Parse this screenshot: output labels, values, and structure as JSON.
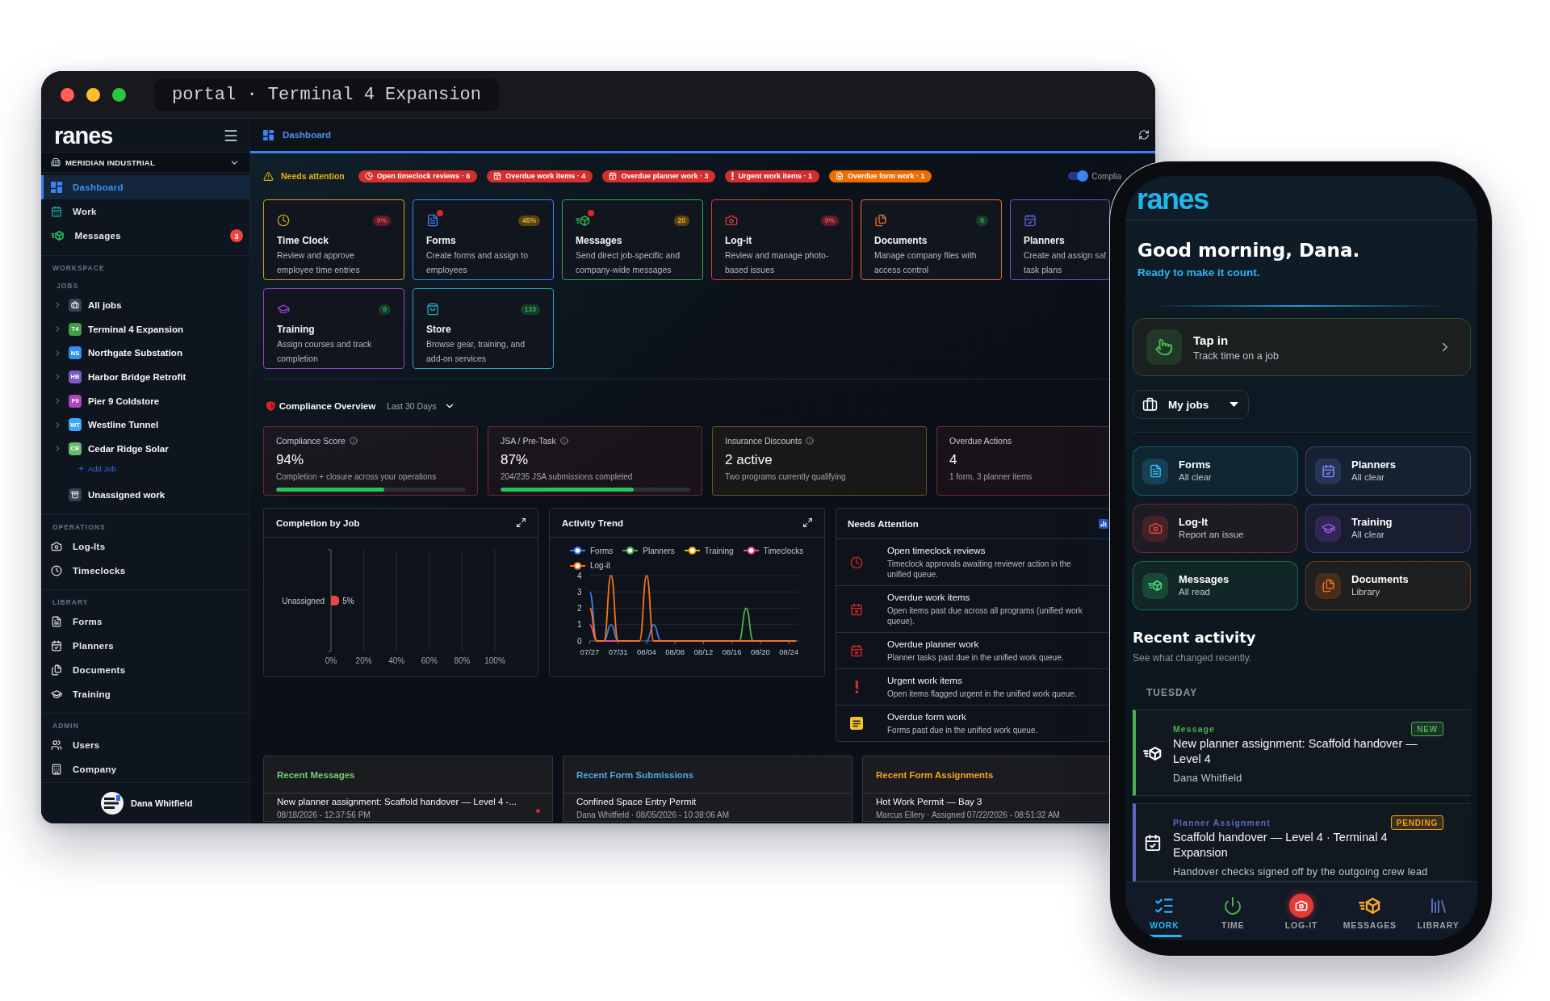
{
  "window": {
    "title": "portal · Terminal 4 Expansion"
  },
  "sidebar": {
    "logo": "ranes",
    "organization": "MERIDIAN INDUSTRIAL",
    "nav": [
      {
        "label": "Dashboard",
        "selected": true
      },
      {
        "label": "Work",
        "selected": false
      },
      {
        "label": "Messages",
        "selected": false,
        "badge": "3"
      }
    ],
    "workspace": {
      "heading": "WORKSPACE",
      "jobs_heading": "JOBS",
      "jobs": [
        {
          "kind": "all",
          "label": "All jobs",
          "expanded": false
        },
        {
          "kind": "job",
          "code": "T4",
          "label": "Terminal 4 Expansion",
          "color": "#43a047",
          "expanded": false
        },
        {
          "kind": "job",
          "code": "NS",
          "label": "Northgate Substation",
          "color": "#2f8ff0",
          "expanded": false
        },
        {
          "kind": "job",
          "code": "HB",
          "label": "Harbor Bridge Retrofit",
          "color": "#7e57c2",
          "expanded": false
        },
        {
          "kind": "job",
          "code": "P9",
          "label": "Pier 9 Coldstore",
          "color": "#ab47bc",
          "expanded": false
        },
        {
          "kind": "job",
          "code": "WT",
          "label": "Westline Tunnel",
          "color": "#42a5f5",
          "expanded": false
        },
        {
          "kind": "job",
          "code": "CR",
          "label": "Cedar Ridge Solar",
          "color": "#66bb6a",
          "expanded": false
        }
      ],
      "add_job": "Add Job",
      "unassigned": "Unassigned work"
    },
    "sections": [
      {
        "heading": "OPERATIONS",
        "items": [
          {
            "label": "Log-Its",
            "selected": false
          },
          {
            "label": "Timeclocks",
            "selected": false
          }
        ]
      },
      {
        "heading": "LIBRARY",
        "items": [
          {
            "label": "Forms",
            "selected": false
          },
          {
            "label": "Planners",
            "selected": false
          },
          {
            "label": "Documents",
            "selected": false
          },
          {
            "label": "Training",
            "selected": false
          }
        ]
      },
      {
        "heading": "ADMIN",
        "items": [
          {
            "label": "Users",
            "selected": false
          },
          {
            "label": "Company",
            "selected": false
          }
        ]
      }
    ],
    "user": {
      "name": "Dana Whitfield"
    }
  },
  "header": {
    "title": "Dashboard"
  },
  "attention": {
    "label": "Needs attention",
    "items": [
      {
        "label": "Open timeclock reviews · 6",
        "color": "#d32f2f"
      },
      {
        "label": "Overdue work items · 4",
        "color": "#d32f2f"
      },
      {
        "label": "Overdue planner work · 3",
        "color": "#d32f2f"
      },
      {
        "label": "Urgent work items · 1",
        "color": "#d32f2f"
      },
      {
        "label": "Overdue form work · 1",
        "color": "#ef6c00"
      }
    ],
    "toggle": {
      "label": "Complia",
      "on": true
    }
  },
  "tiles": [
    {
      "title": "Time Clock",
      "description": "Review and approve\nemployee time entries",
      "badge": {
        "text": "0%",
        "color": "#5a1f22"
      },
      "color": "#cf9f1f",
      "notification": false
    },
    {
      "title": "Forms",
      "description": "Create forms and assign to\nemployees",
      "badge": {
        "text": "45%",
        "color": "#5a4312"
      },
      "color": "#3b82f6",
      "notification": true
    },
    {
      "title": "Messages",
      "description": "Send direct job-specific and\ncompany-wide messages",
      "badge": {
        "text": "20",
        "color": "#5a4312"
      },
      "color": "#2eaa4f",
      "notification": true
    },
    {
      "title": "Log-it",
      "description": "Review and manage photo-\nbased issues",
      "badge": {
        "text": "0%",
        "color": "#5a1f22"
      },
      "color": "#dc3b3b",
      "notification": false
    },
    {
      "title": "Documents",
      "description": "Manage company files with\naccess control",
      "badge": {
        "text": "6",
        "color": "#173f26"
      },
      "color": "#e8702a",
      "notification": false
    },
    {
      "title": "Planners",
      "description": "Create and assign saf\ntask plans",
      "color": "#5b5fd6",
      "notification": false
    },
    {
      "title": "Training",
      "description": "Assign courses and track\ncompletion",
      "badge": {
        "text": "0",
        "color": "#173f26"
      },
      "color": "#9b3fc8",
      "notification": false
    },
    {
      "title": "Store",
      "description": "Browse gear, training, and\nadd-on services",
      "badge": {
        "text": "133",
        "color": "#173f26"
      },
      "color": "#1fa7c0",
      "notification": false
    }
  ],
  "compliance": {
    "title": "Compliance Overview",
    "period": "Last 30 Days",
    "cards": [
      {
        "label": "Compliance Score",
        "info": true,
        "value": "94%",
        "note": "Completion + closure across your operations",
        "level": 0.57,
        "color": "#6e2a2e"
      },
      {
        "label": "JSA / Pre-Task",
        "info": true,
        "value": "87%",
        "note": "204/235 JSA submissions completed",
        "level": 0.7,
        "color": "#6e2a2e"
      },
      {
        "label": "Insurance Discounts",
        "info": true,
        "value": "2 active",
        "note": "Two programs currently qualifying",
        "color": "#6b5220"
      },
      {
        "label": "Overdue Actions",
        "info": false,
        "value": "4",
        "note": "1 form, 3 planner items",
        "color": "#6e2a2e"
      }
    ]
  },
  "completion": {
    "title": "Completion by Job",
    "chart_data": {
      "type": "bar",
      "orientation": "horizontal",
      "categories": [
        "Unassigned"
      ],
      "values": [
        5
      ],
      "xlim": [
        0,
        100
      ],
      "xticks": [
        {
          "value": 0,
          "label": "0%"
        },
        {
          "value": 20,
          "label": "20%"
        },
        {
          "value": 40,
          "label": "40%"
        },
        {
          "value": 60,
          "label": "60%"
        },
        {
          "value": 80,
          "label": "80%"
        },
        {
          "value": 100,
          "label": "100%"
        }
      ],
      "value_labels": [
        "5%"
      ],
      "grid": true
    }
  },
  "activity": {
    "title": "Activity Trend",
    "chart_data": {
      "type": "line",
      "categories": [
        "07/27",
        null,
        null,
        null,
        "07/31",
        null,
        null,
        null,
        "08/04",
        null,
        null,
        null,
        "08/08",
        null,
        null,
        null,
        "08/12",
        null,
        null,
        null,
        "08/16",
        null,
        null,
        null,
        "08/20",
        null,
        null,
        null,
        "08/24",
        null
      ],
      "series": [
        {
          "name": "Forms",
          "color": "#3b82f6",
          "values": [
            3,
            0,
            0,
            1,
            0,
            null,
            null,
            null,
            0,
            1,
            0,
            null,
            null,
            null,
            null,
            null,
            null,
            null,
            null,
            null,
            null,
            null,
            null,
            null,
            null,
            null,
            null,
            null,
            null,
            null
          ]
        },
        {
          "name": "Planners",
          "color": "#4caf50",
          "values": [
            null,
            null,
            null,
            null,
            null,
            null,
            null,
            null,
            null,
            null,
            null,
            null,
            null,
            null,
            null,
            null,
            null,
            null,
            null,
            null,
            null,
            0,
            2,
            0,
            null,
            null,
            null,
            null,
            null,
            null
          ]
        },
        {
          "name": "Training",
          "color": "#eab308",
          "values": [
            null,
            null,
            null,
            null,
            null,
            null,
            null,
            null,
            null,
            null,
            null,
            null,
            null,
            null,
            null,
            null,
            null,
            null,
            null,
            null,
            null,
            null,
            null,
            null,
            null,
            null,
            null,
            null,
            null,
            null
          ]
        },
        {
          "name": "Timeclocks",
          "color": "#ec4899",
          "values": [
            1,
            0,
            0,
            0,
            0,
            null,
            null,
            null,
            null,
            null,
            null,
            null,
            null,
            null,
            null,
            null,
            null,
            null,
            null,
            null,
            null,
            null,
            null,
            null,
            null,
            null,
            null,
            null,
            null,
            null
          ]
        },
        {
          "name": "Log-it",
          "color": "#f97316",
          "values": [
            2,
            0,
            0,
            4,
            0,
            0,
            0,
            0,
            4,
            0,
            0,
            0,
            0,
            0,
            0,
            0,
            0,
            0,
            0,
            0,
            0,
            0,
            0,
            0,
            0,
            0,
            0,
            0,
            0,
            0
          ]
        }
      ],
      "ylim": [
        0,
        4
      ],
      "yticks": [
        0,
        1,
        2,
        3,
        4
      ],
      "grid": true,
      "legend": "top"
    }
  },
  "needs_attention": {
    "title": "Needs Attention",
    "items": [
      {
        "title": "Open timeclock reviews",
        "description": "Timeclock approvals awaiting reviewer action in the\nunified queue."
      },
      {
        "title": "Overdue work items",
        "description": "Open items past due across all programs (unified work\nqueue)."
      },
      {
        "title": "Overdue planner work",
        "description": "Planner tasks past due in the unified work queue."
      },
      {
        "title": "Urgent work items",
        "description": "Open items flagged urgent in the unified work queue."
      },
      {
        "title": "Overdue form work",
        "description": "Forms past due in the unified work queue."
      }
    ]
  },
  "recent": [
    {
      "title": "Recent Messages",
      "color": "#6fcf73",
      "rows": [
        {
          "title": "New planner assignment: Scaffold handover — Level 4 -...",
          "meta": "08/18/2026 - 12:37:56 PM",
          "unread": true
        }
      ]
    },
    {
      "title": "Recent Form Submissions",
      "color": "#4ea8ea",
      "rows": [
        {
          "title": "Confined Space Entry Permit",
          "meta": "Dana Whitfield · 08/05/2026 - 10:38:06 AM",
          "unread": false
        }
      ]
    },
    {
      "title": "Recent Form Assignments",
      "color": "#f5a524",
      "rows": [
        {
          "title": "Hot Work Permit — Bay 3",
          "meta": "Marcus Ellery · Assigned 07/22/2026 - 08:51:32 AM",
          "unread": false
        }
      ]
    }
  ],
  "phone": {
    "logo": "ranes",
    "greeting": "Good morning, Dana.",
    "tagline": "Ready to make it count.",
    "tap_in": {
      "title": "Tap in",
      "subtitle": "Track time on a job"
    },
    "jobs_menu": {
      "label": "My jobs"
    },
    "shortcuts": [
      {
        "title": "Forms",
        "status": "All clear",
        "color": "#38bdf8"
      },
      {
        "title": "Planners",
        "status": "All clear",
        "color": "#818cf8"
      },
      {
        "title": "Log-It",
        "status": "Report an issue",
        "color": "#ef4444"
      },
      {
        "title": "Training",
        "status": "All clear",
        "color": "#a855f7"
      },
      {
        "title": "Messages",
        "status": "All read",
        "color": "#4ade80"
      },
      {
        "title": "Documents",
        "status": "Library",
        "color": "#f97316"
      }
    ],
    "activity": {
      "title": "Recent activity",
      "subtitle": "See what changed recently.",
      "day": "TUESDAY",
      "items": [
        {
          "kind": "message",
          "type": "Message",
          "title": "New planner assignment: Scaffold handover — Level 4",
          "note": "Dana Whitfield",
          "badge": {
            "text": "NEW",
            "color": "#4caf50"
          },
          "color": "#4caf50"
        },
        {
          "kind": "planner",
          "type": "Planner Assignment",
          "title": "Scaffold handover — Level 4 · Terminal 4 Expansion",
          "note": "Handover checks signed off by the outgoing crew lead",
          "badge": {
            "text": "PENDING",
            "color": "#f59e0b"
          },
          "color": "#5c6bc0"
        }
      ]
    },
    "nav": [
      {
        "label": "WORK",
        "selected": true,
        "color": "#29b6f6"
      },
      {
        "label": "TIME",
        "selected": false,
        "color": "#4caf50"
      },
      {
        "label": "LOG-IT",
        "selected": false,
        "color": "#e53935"
      },
      {
        "label": "MESSAGES",
        "selected": false,
        "color": "#f5a623"
      },
      {
        "label": "LIBRARY",
        "selected": false,
        "color": "#5c6bc0"
      }
    ]
  }
}
